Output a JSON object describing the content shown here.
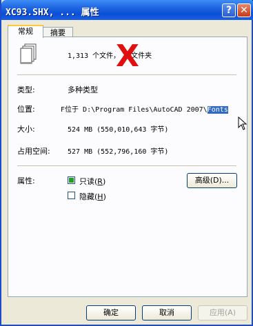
{
  "window": {
    "title": "XC93.SHX, ... 属性"
  },
  "titlebar_buttons": {
    "help": "?",
    "close": "✕"
  },
  "tabs": [
    {
      "label": "常规"
    },
    {
      "label": "摘要"
    }
  ],
  "summary": {
    "text": "1,313 个文件，  个文件夹"
  },
  "overlay": {
    "mark": "X",
    "color": "#e01010"
  },
  "fields": {
    "type": {
      "label": "类型:",
      "value": "多种类型"
    },
    "location": {
      "label": "位置:",
      "prefix": "F",
      "value": "位于 D:\\Program Files\\AutoCAD 2007\\",
      "selected": "Fonts"
    },
    "size": {
      "label": "大小:",
      "value": "524 MB (550,010,643 字节)"
    },
    "size_on_disk": {
      "label": "占用空间:",
      "value": "527 MB (552,796,160 字节)"
    }
  },
  "attributes": {
    "label": "属性:",
    "readonly": {
      "label": "只读",
      "hotkey": "R",
      "checked": true
    },
    "hidden": {
      "label": "隐藏",
      "hotkey": "H",
      "checked": false
    },
    "advanced_button": "高级(D)..."
  },
  "buttons": {
    "ok": "确定",
    "cancel": "取消",
    "apply": "应用(A)"
  }
}
